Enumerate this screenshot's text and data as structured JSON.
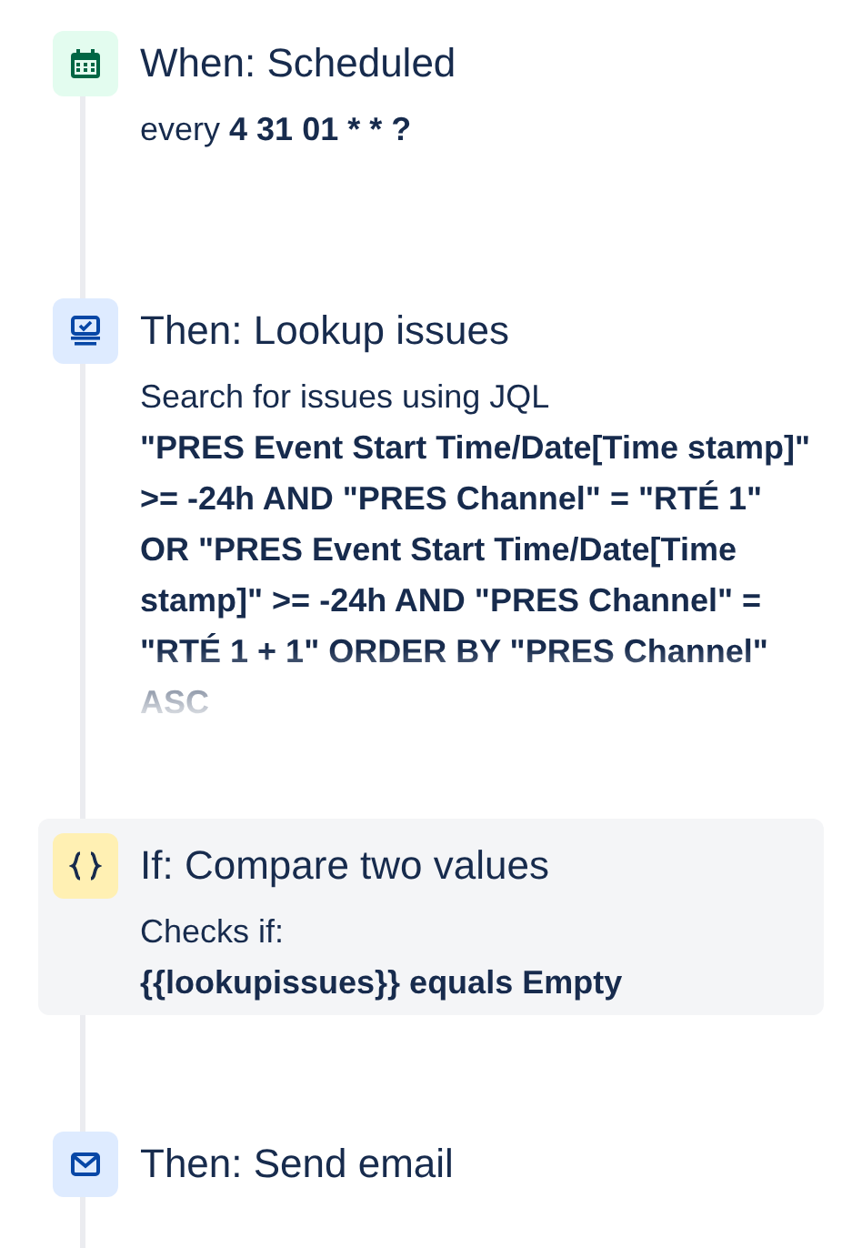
{
  "steps": [
    {
      "kind": "trigger",
      "title": "When: Scheduled",
      "highlighted": false,
      "lines": [
        {
          "text": "every **4 31 01 * * ?**",
          "bold": false,
          "faded": false
        }
      ]
    },
    {
      "kind": "lookup",
      "title": "Then: Lookup issues",
      "highlighted": false,
      "lines": [
        {
          "text": "Search for issues using JQL",
          "bold": false,
          "faded": false
        },
        {
          "text": "\"PRES Event Start Time/Date[Time stamp]\" >= -24h AND \"PRES Channel\" = \"RTÉ 1\" OR \"PRES Event Start Time/Date[Time stamp]\" >= -24h AND \"PRES Channel\" = \"RTÉ 1 + 1\" ORDER BY \"PRES Channel\" ASC",
          "bold": true,
          "faded": true
        }
      ]
    },
    {
      "kind": "condition",
      "title": "If: Compare two values",
      "highlighted": true,
      "lines": [
        {
          "text": "Checks if:",
          "bold": false,
          "faded": false
        },
        {
          "text": "{{lookupissues}} equals Empty",
          "bold": true,
          "faded": false
        }
      ]
    },
    {
      "kind": "email",
      "title": "Then: Send email",
      "highlighted": false
    }
  ]
}
